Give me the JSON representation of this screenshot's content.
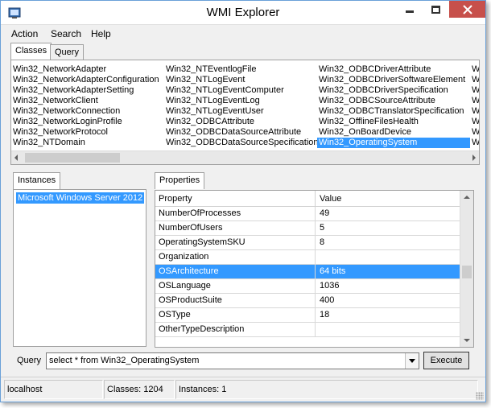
{
  "window": {
    "title": "WMI Explorer"
  },
  "menu": {
    "items": [
      "Action",
      "Search",
      "Help"
    ]
  },
  "top_tabs": [
    "Classes",
    "Query"
  ],
  "classes": {
    "columns": [
      [
        "Win32_NetworkAdapter",
        "Win32_NetworkAdapterConfiguration",
        "Win32_NetworkAdapterSetting",
        "Win32_NetworkClient",
        "Win32_NetworkConnection",
        "Win32_NetworkLoginProfile",
        "Win32_NetworkProtocol",
        "Win32_NTDomain"
      ],
      [
        "Win32_NTEventlogFile",
        "Win32_NTLogEvent",
        "Win32_NTLogEventComputer",
        "Win32_NTLogEventLog",
        "Win32_NTLogEventUser",
        "Win32_ODBCAttribute",
        "Win32_ODBCDataSourceAttribute",
        "Win32_ODBCDataSourceSpecification"
      ],
      [
        "Win32_ODBCDriverAttribute",
        "Win32_ODBCDriverSoftwareElement",
        "Win32_ODBCDriverSpecification",
        "Win32_ODBCSourceAttribute",
        "Win32_ODBCTranslatorSpecification",
        "Win32_OfflineFilesHealth",
        "Win32_OnBoardDevice",
        "Win32_OperatingSystem"
      ],
      [
        "W",
        "W",
        "W",
        "W",
        "W",
        "W",
        "W",
        "W"
      ]
    ],
    "selected": "Win32_OperatingSystem"
  },
  "instances": {
    "tab": "Instances",
    "items": [
      "Microsoft Windows Server 2012"
    ]
  },
  "properties": {
    "tab": "Properties",
    "headers": {
      "property": "Property",
      "value": "Value"
    },
    "rows": [
      {
        "property": "NumberOfProcesses",
        "value": "49"
      },
      {
        "property": "NumberOfUsers",
        "value": "5"
      },
      {
        "property": "OperatingSystemSKU",
        "value": "8"
      },
      {
        "property": "Organization",
        "value": ""
      },
      {
        "property": "OSArchitecture",
        "value": "64 bits"
      },
      {
        "property": "OSLanguage",
        "value": "1036"
      },
      {
        "property": "OSProductSuite",
        "value": "400"
      },
      {
        "property": "OSType",
        "value": "18"
      },
      {
        "property": "OtherTypeDescription",
        "value": ""
      }
    ],
    "selected_row": "OSArchitecture"
  },
  "query": {
    "label": "Query",
    "value": "select * from Win32_OperatingSystem",
    "execute_label": "Execute"
  },
  "status": {
    "host": "localhost",
    "classes": "Classes: 1204",
    "instances": "Instances: 1"
  },
  "colors": {
    "selection": "#3399ff",
    "close_button": "#c7504b"
  },
  "icons": [
    "app-icon",
    "minimize-icon",
    "maximize-icon",
    "close-icon",
    "dropdown-arrow-icon",
    "size-grip-icon"
  ]
}
